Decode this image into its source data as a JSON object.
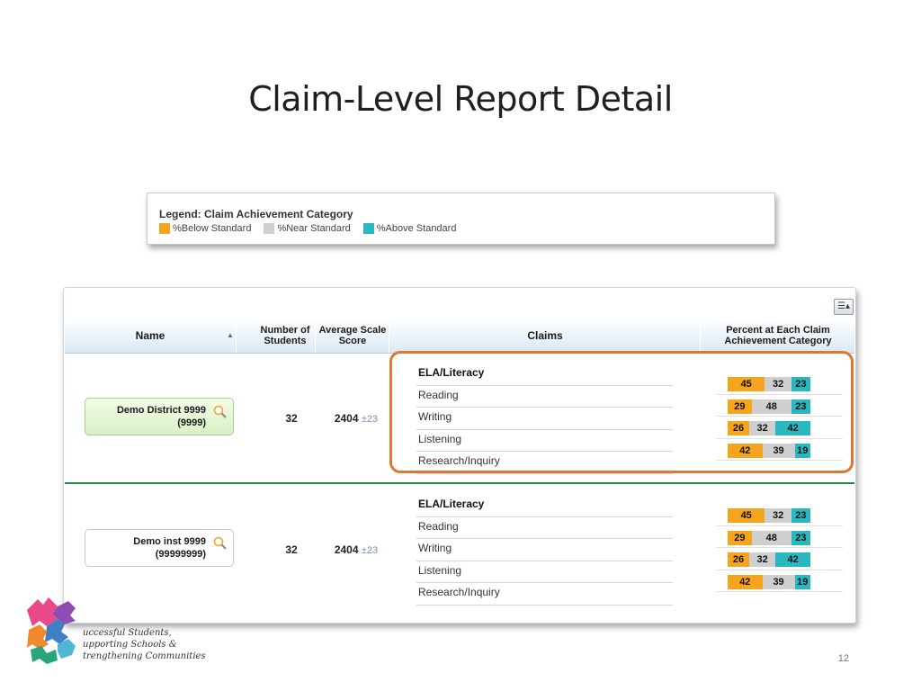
{
  "slide": {
    "title": "Claim-Level Report Detail",
    "page_number": "12"
  },
  "legend": {
    "title": "Legend: Claim Achievement Category",
    "items": [
      {
        "label": "%Below Standard",
        "color": "#f5a41b"
      },
      {
        "label": "%Near Standard",
        "color": "#cfcfcf"
      },
      {
        "label": "%Above Standard",
        "color": "#29b8bf"
      }
    ]
  },
  "table": {
    "settings_icon": "list-menu-icon",
    "headers": {
      "name": "Name",
      "students": "Number of Students",
      "avg": "Average Scale Score",
      "claims": "Claims",
      "percent": "Percent at Each Claim Achievement Category"
    },
    "rows": [
      {
        "name": "Demo District 9999",
        "id": "(9999)",
        "students": "32",
        "avg": "2404",
        "err": "±23",
        "claims": [
          "ELA/Literacy",
          "Reading",
          "Writing",
          "Listening",
          "Research/Inquiry"
        ],
        "bars": [
          [
            45,
            32,
            23
          ],
          [
            29,
            48,
            23
          ],
          [
            26,
            32,
            42
          ],
          [
            42,
            39,
            19
          ]
        ]
      },
      {
        "name": "Demo inst 9999",
        "id": "(99999999)",
        "students": "32",
        "avg": "2404",
        "err": "±23",
        "claims": [
          "ELA/Literacy",
          "Reading",
          "Writing",
          "Listening",
          "Research/Inquiry"
        ],
        "bars": [
          [
            45,
            32,
            23
          ],
          [
            29,
            48,
            23
          ],
          [
            26,
            32,
            42
          ],
          [
            42,
            39,
            19
          ]
        ]
      }
    ]
  },
  "branding": {
    "tagline": [
      "uccessful Students,",
      "upporting Schools &",
      "trengthening Communities"
    ]
  }
}
